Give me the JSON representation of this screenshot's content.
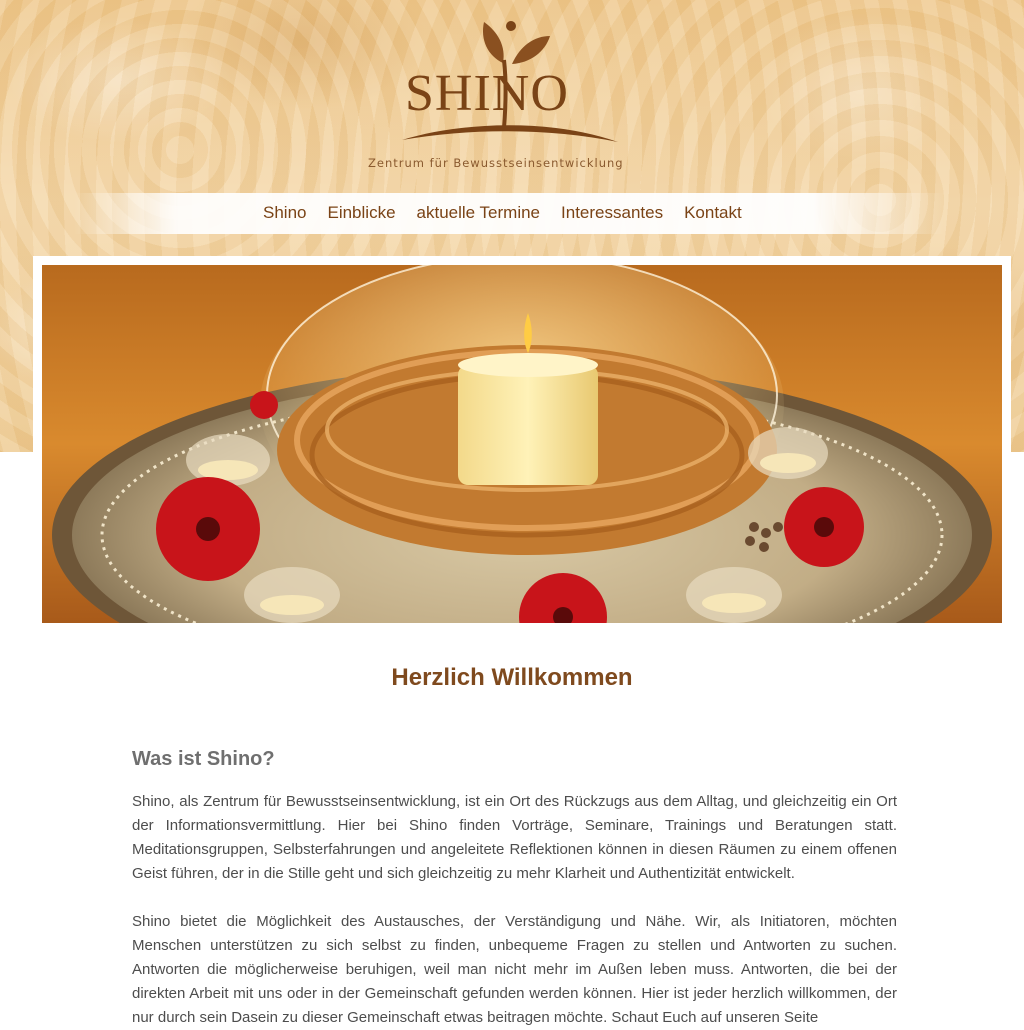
{
  "brand": {
    "name": "SHINO",
    "tagline": "Zentrum für Bewusstseinsentwicklung"
  },
  "nav": {
    "items": [
      {
        "label": "Shino"
      },
      {
        "label": "Einblicke"
      },
      {
        "label": "aktuelle Termine"
      },
      {
        "label": "Interessantes"
      },
      {
        "label": "Kontakt"
      }
    ]
  },
  "content": {
    "welcome_title": "Herzlich Willkommen",
    "section_title": "Was ist Shino?",
    "paragraphs": [
      "Shino, als Zentrum für Bewusstseinsentwicklung, ist ein Ort des Rückzugs aus dem Alltag, und gleichzeitig ein Ort der Informationsvermittlung. Hier bei Shino finden Vorträge, Seminare, Trainings und Beratungen statt. Meditationsgruppen, Selbsterfahrungen und angeleitete Reflektionen können in diesen Räumen zu einem offenen Geist führen, der in die Stille geht und sich gleichzeitig zu mehr Klarheit und Authentizität entwickelt.",
      "Shino bietet die Möglichkeit des Austausches, der Verständigung und Nähe. Wir, als Initiatoren, möchten Menschen unterstützen zu sich selbst zu finden, unbequeme Fragen zu stellen und Antworten zu suchen. Antworten die möglicherweise beruhigen, weil man nicht mehr im Außen leben muss. Antworten, die bei der direkten Arbeit mit uns oder in der Gemeinschaft gefunden werden können. Hier ist jeder herzlich willkommen, der nur durch sein Dasein zu dieser Gemeinschaft etwas beitragen möchte. Schaut Euch auf unseren Seite"
    ]
  },
  "colors": {
    "brand_brown": "#7a4316",
    "heading_brown": "#7f4a1e",
    "heading_gray": "#6f6f6f",
    "body_text": "#4d4d4d",
    "gold_background": "#f2d3a0"
  },
  "icons": {
    "logo_mark": "leaf-figure-icon"
  }
}
